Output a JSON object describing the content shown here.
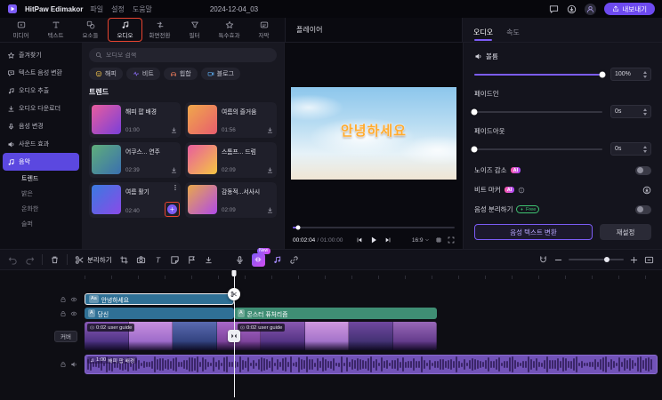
{
  "colors": {
    "accent": "#7c5cf5",
    "annotation_red": "#e8442f",
    "ai_badge_from": "#ff5ba8",
    "ai_badge_to": "#a94cff",
    "free_badge": "#3fc472",
    "text_clip": "#2f7095",
    "subtitle_clip": "#3f8e74",
    "audio_clip": "#7253b8"
  },
  "titlebar": {
    "app_name": "HitPaw Edimakor",
    "menu": [
      "파일",
      "설정",
      "도움말"
    ],
    "project_name": "2024-12-04_03",
    "export_label": "내보내기"
  },
  "ribbon": {
    "tabs": [
      {
        "label": "미디어",
        "icon": "media"
      },
      {
        "label": "텍스트",
        "icon": "text"
      },
      {
        "label": "요소들",
        "icon": "elements"
      },
      {
        "label": "오디오",
        "icon": "audio",
        "annotated": true
      },
      {
        "label": "화면전환",
        "icon": "transition"
      },
      {
        "label": "필터",
        "icon": "filter"
      },
      {
        "label": "특수효과",
        "icon": "effects"
      },
      {
        "label": "자막",
        "icon": "subtitles"
      }
    ],
    "player_title": "플레이어"
  },
  "sidebar": {
    "items": [
      {
        "label": "즐겨찾기",
        "icon": "star"
      },
      {
        "label": "텍스트 음성 변환",
        "icon": "tts"
      },
      {
        "label": "오디오 추출",
        "icon": "extract"
      },
      {
        "label": "오디오 다운로더",
        "icon": "downloader"
      },
      {
        "label": "음성 변경",
        "icon": "voice"
      },
      {
        "label": "사운드 효과",
        "icon": "sfx"
      },
      {
        "label": "음악",
        "icon": "music",
        "active": true
      }
    ],
    "subitems": [
      {
        "label": "트렌드",
        "active": true
      },
      {
        "label": "밝은"
      },
      {
        "label": "온화한"
      },
      {
        "label": "슬퍼"
      }
    ]
  },
  "music_panel": {
    "search_placeholder": "오디오 검색",
    "categories": [
      {
        "label": "해피",
        "icon": "happy",
        "color": "#f0c24a"
      },
      {
        "label": "비트",
        "icon": "beat",
        "color": "#8a6cf5"
      },
      {
        "label": "힙합",
        "icon": "hiphop",
        "color": "#e87a5a"
      },
      {
        "label": "블로그",
        "icon": "vlog",
        "color": "#5aa8e8"
      }
    ],
    "section_title": "트렌드",
    "tracks": [
      {
        "title": "해피 팝 배경",
        "duration": "01:00",
        "thumb": [
          "#e85d9e",
          "#7a3fd9"
        ]
      },
      {
        "title": "여름의 즐거움",
        "duration": "01:56",
        "thumb": [
          "#f0a84a",
          "#e85d6e"
        ]
      },
      {
        "title": "어쿠스... 연주",
        "duration": "02:39",
        "thumb": [
          "#5fae7a",
          "#3a6fb0"
        ]
      },
      {
        "title": "스톰프... 드럼",
        "duration": "02:09",
        "thumb": [
          "#e85d9e",
          "#f5c542"
        ]
      },
      {
        "title": "여름 활기",
        "duration": "02:40",
        "thumb": [
          "#3a7ae0",
          "#8a4ae8"
        ],
        "selected": true
      },
      {
        "title": "감동적...서사시",
        "duration": "02:09",
        "thumb": [
          "#e8a84a",
          "#b04ae8"
        ]
      }
    ]
  },
  "player": {
    "overlay_text": "안녕하세요",
    "time_current": "00:02:04",
    "time_separator": "/",
    "time_total": "01:00:00",
    "progress_percent": 3.4,
    "aspect_ratio": "16:9"
  },
  "properties": {
    "tab_audio": "오디오",
    "tab_speed": "속도",
    "volume": {
      "label": "볼륨",
      "value": "100%",
      "percent": 100
    },
    "fade_in": {
      "label": "페이드인",
      "value": "0s",
      "percent": 0
    },
    "fade_out": {
      "label": "페이드아웃",
      "value": "0s",
      "percent": 0
    },
    "noise_reduction": {
      "label": "노이즈 감소",
      "badge": "AI",
      "enabled": false
    },
    "beat_marker": {
      "label": "비트 마커",
      "badge": "AI"
    },
    "vocal_separation": {
      "label": "음성 분리하기",
      "badge": "Free",
      "enabled": false
    },
    "stt_button": "음성 텍스트 변환",
    "reset_button": "재설정"
  },
  "timeline": {
    "split_label": "분리하기",
    "new_badge": "New",
    "cover_button": "커버",
    "clips": {
      "text_icon": "Aa",
      "text1": "안녕하세요",
      "text2_icon": "A",
      "text2": "당신",
      "subtitle_icon": "A",
      "subtitle": "몬스터 퓨처리즘",
      "video1_time": "0:02",
      "video1_name": "user guide",
      "video2_time": "0:02",
      "video2_name": "user guide",
      "audio_time": "1:00",
      "audio_name": "해피 팝 배경"
    }
  }
}
